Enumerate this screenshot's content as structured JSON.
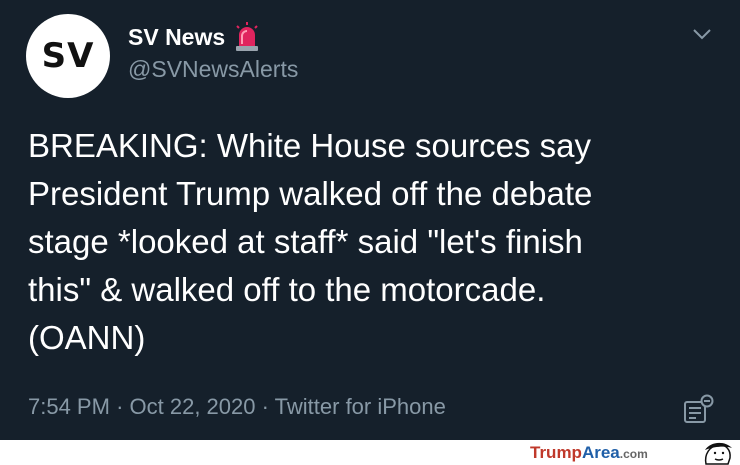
{
  "tweet": {
    "avatar_text": "SV",
    "display_name": "SV News",
    "badge_icon": "siren-icon",
    "handle": "@SVNewsAlerts",
    "body_lines": [
      "BREAKING: White House sources say",
      "President Trump walked off the debate",
      "stage *looked at staff* said \"let's finish",
      "this\" & walked off to the motorcade.",
      "(OANN)"
    ],
    "time": "7:54 PM",
    "date": "Oct 22, 2020",
    "source": "Twitter for iPhone",
    "separator": "·"
  },
  "watermark": {
    "trump": "Trump",
    "area": "Area",
    "com": ".com"
  },
  "colors": {
    "background": "#15202b",
    "text": "#ffffff",
    "secondary": "#8899a6",
    "siren_red": "#e0245e"
  }
}
